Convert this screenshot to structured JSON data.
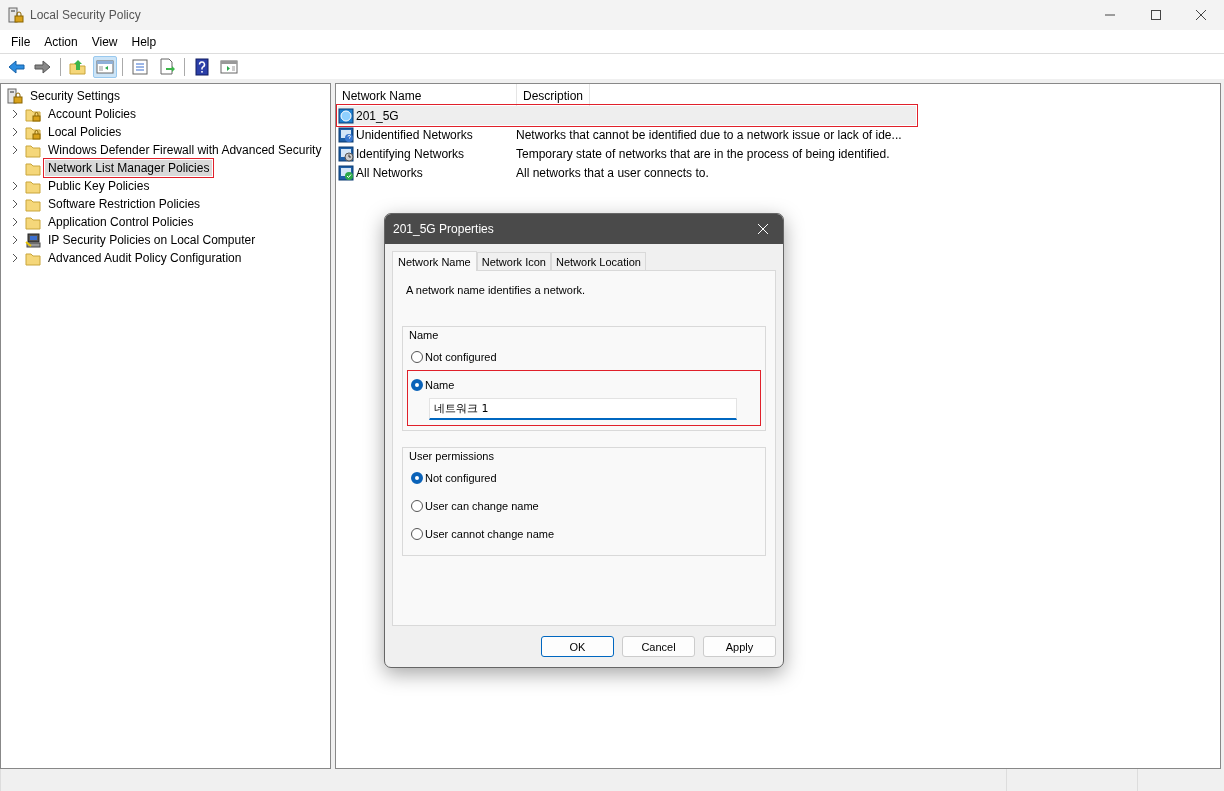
{
  "window": {
    "title": "Local Security Policy"
  },
  "menu": [
    "File",
    "Action",
    "View",
    "Help"
  ],
  "toolbar": [
    {
      "kind": "back",
      "pressed": false
    },
    {
      "kind": "forward",
      "pressed": false
    },
    {
      "kind": "up",
      "pressed": false
    },
    {
      "kind": "tree",
      "pressed": true
    },
    {
      "kind": "properties",
      "pressed": false
    },
    {
      "kind": "export",
      "pressed": false
    },
    {
      "kind": "help",
      "pressed": false
    },
    {
      "kind": "panel",
      "pressed": false
    }
  ],
  "tree": {
    "label": "Security Settings",
    "children": [
      {
        "label": "Account Policies",
        "kind": "lockedfolder",
        "expandable": true,
        "selected": false,
        "highlighted": false
      },
      {
        "label": "Local Policies",
        "kind": "lockedfolder",
        "expandable": true,
        "selected": false,
        "highlighted": false
      },
      {
        "label": "Windows Defender Firewall with Advanced Security",
        "kind": "folder",
        "expandable": true,
        "selected": false,
        "highlighted": false
      },
      {
        "label": "Network List Manager Policies",
        "kind": "folder",
        "expandable": false,
        "selected": true,
        "highlighted": true
      },
      {
        "label": "Public Key Policies",
        "kind": "folder",
        "expandable": true,
        "selected": false,
        "highlighted": false
      },
      {
        "label": "Software Restriction Policies",
        "kind": "folder",
        "expandable": true,
        "selected": false,
        "highlighted": false
      },
      {
        "label": "Application Control Policies",
        "kind": "folder",
        "expandable": true,
        "selected": false,
        "highlighted": false
      },
      {
        "label": "IP Security Policies on Local Computer",
        "kind": "computer",
        "expandable": true,
        "selected": false,
        "highlighted": false
      },
      {
        "label": "Advanced Audit Policy Configuration",
        "kind": "folder",
        "expandable": true,
        "selected": false,
        "highlighted": false
      }
    ]
  },
  "table": {
    "columns": [
      "Network Name",
      "Description"
    ],
    "rows": [
      {
        "name": "201_5G",
        "kind": "network",
        "selected": true,
        "highlighted": true
      },
      {
        "name": "Unidentified Networks",
        "description": "Networks that cannot be identified due to a network issue or lack of ide...",
        "kind": "unknown",
        "selected": false,
        "highlighted": false
      },
      {
        "name": "Identifying Networks",
        "description": "Temporary state of networks that are in the process of being identified.",
        "kind": "clock",
        "selected": false,
        "highlighted": false
      },
      {
        "name": "All Networks",
        "description": "All networks that a user connects to.",
        "kind": "check",
        "selected": false,
        "highlighted": false
      }
    ]
  },
  "dialog": {
    "title": "201_5G Properties",
    "tabs": [
      {
        "label": "Network Name",
        "selected": true
      },
      {
        "label": "Network Icon",
        "selected": false
      },
      {
        "label": "Network Location",
        "selected": false
      }
    ],
    "intro": "A network name identifies a network.",
    "groups": [
      {
        "label": "Name",
        "options": [
          {
            "label": "Not configured",
            "selected": false,
            "highlighted": false
          },
          {
            "label": "Name",
            "selected": true,
            "highlighted": true,
            "value": "네트워크 1"
          }
        ]
      },
      {
        "label": "User permissions",
        "options": [
          {
            "label": "Not configured",
            "selected": true,
            "highlighted": false
          },
          {
            "label": "User can change name",
            "selected": false,
            "highlighted": false
          },
          {
            "label": "User cannot change name",
            "selected": false,
            "highlighted": false
          }
        ]
      }
    ],
    "buttons": [
      {
        "label": "OK",
        "default": true
      },
      {
        "label": "Cancel",
        "default": false
      },
      {
        "label": "Apply",
        "default": false
      }
    ]
  }
}
